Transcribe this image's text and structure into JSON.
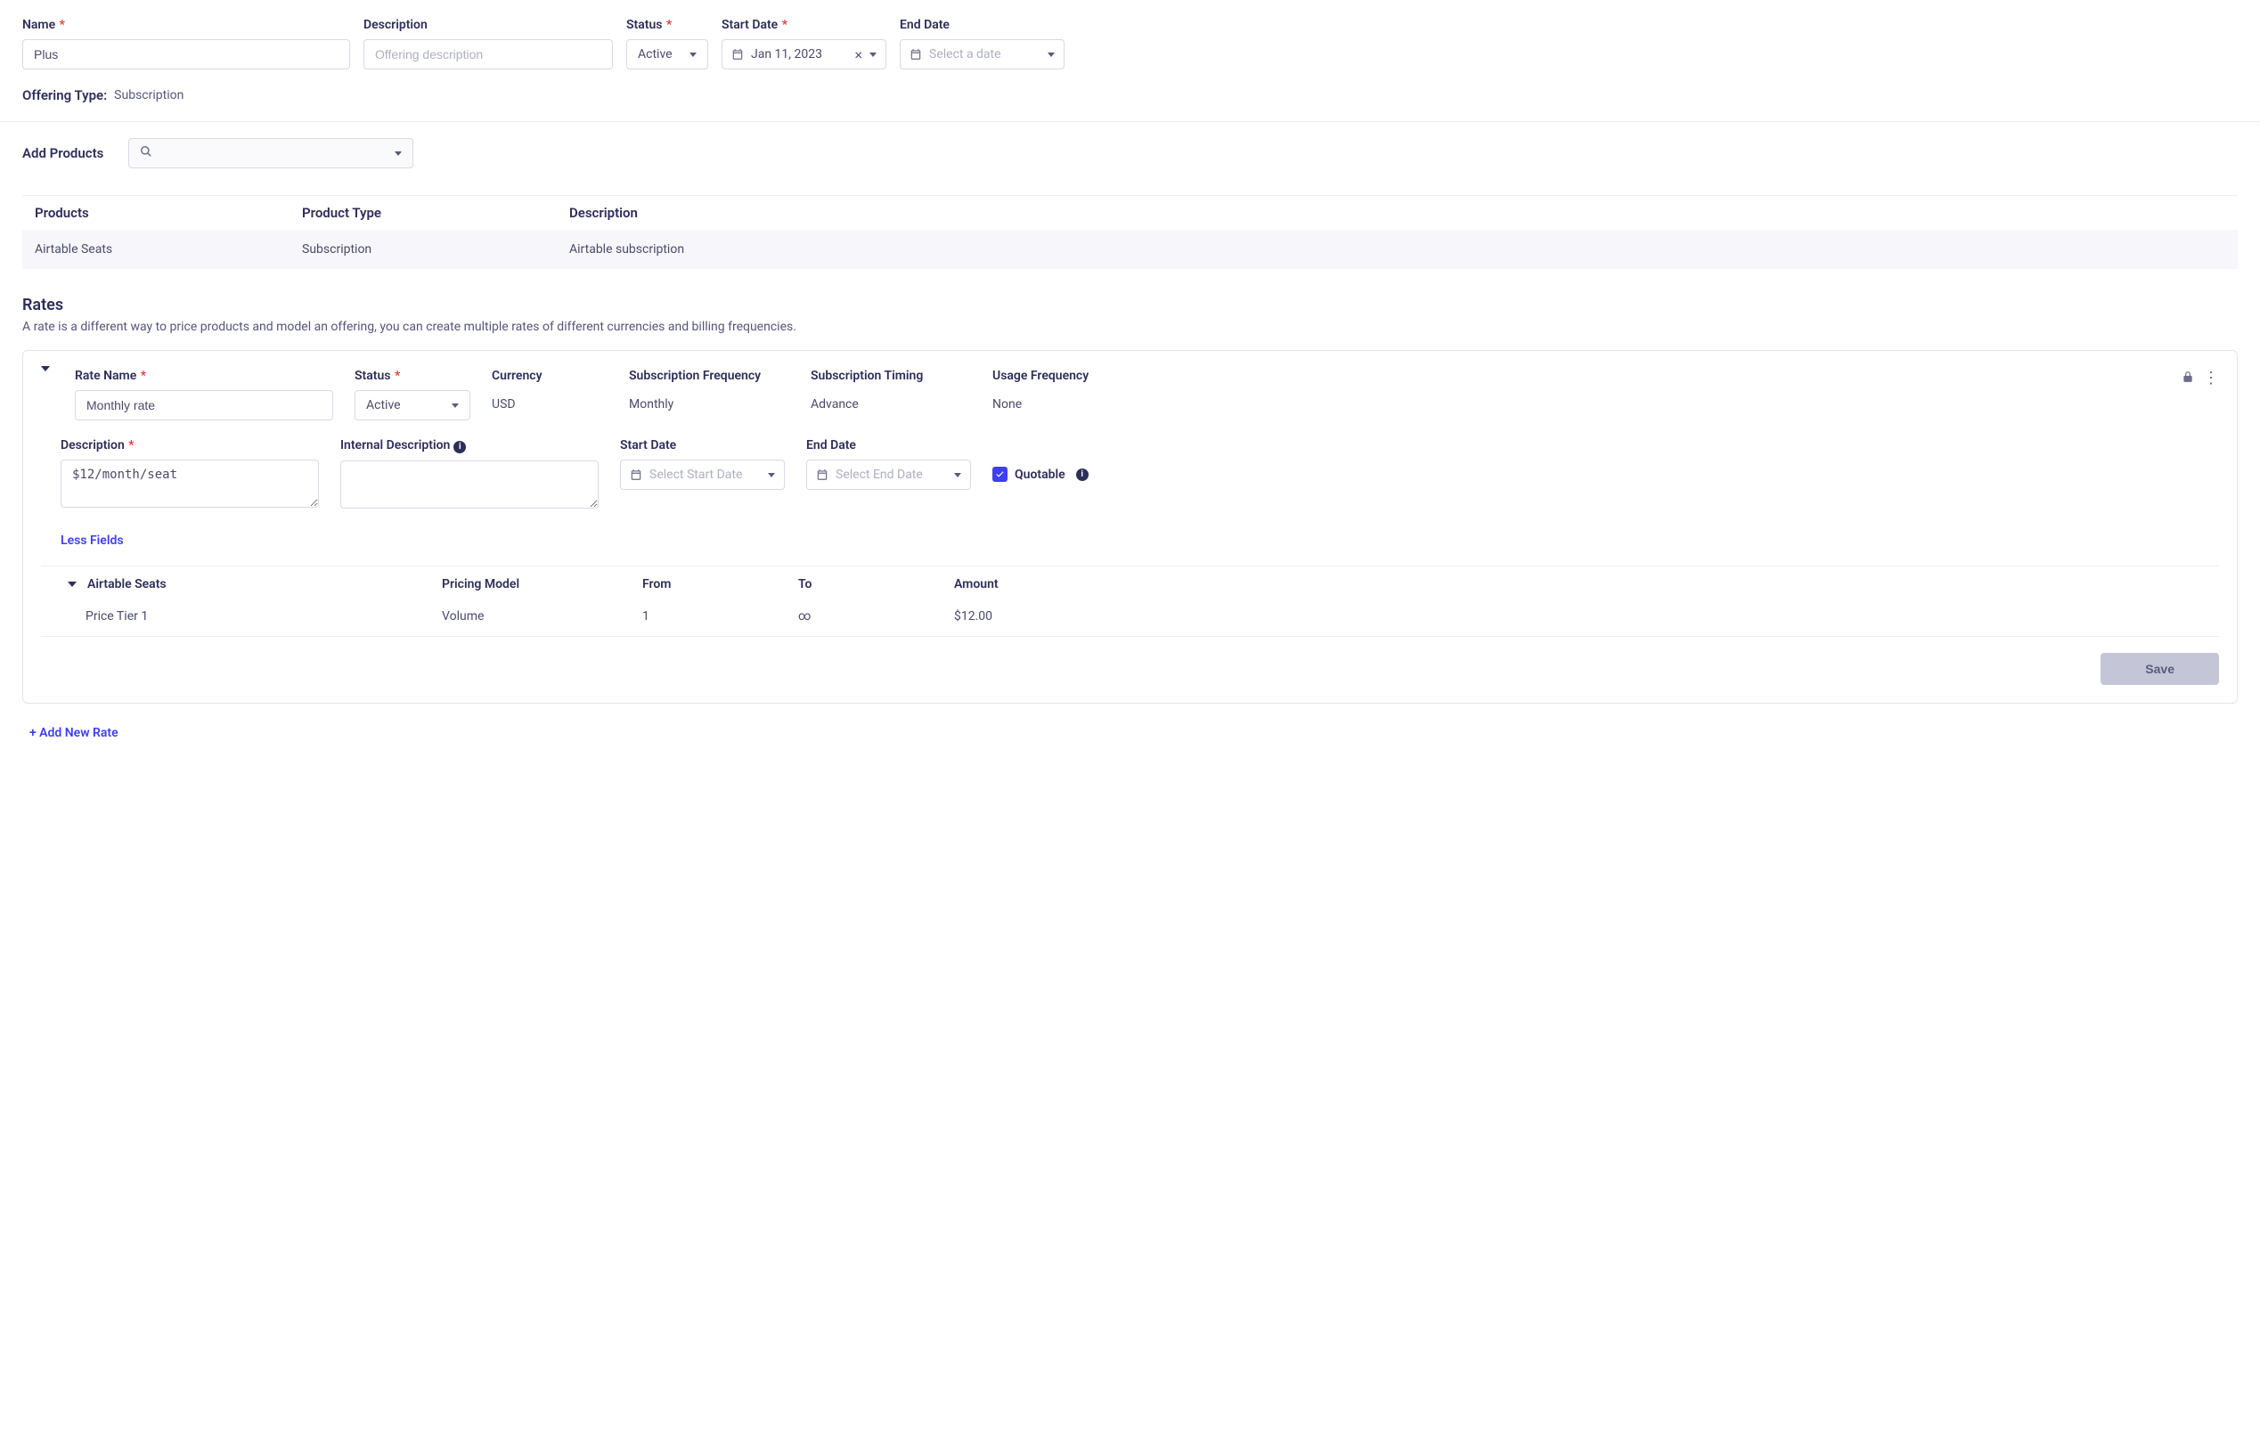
{
  "header": {
    "name_label": "Name",
    "name_value": "Plus",
    "description_label": "Description",
    "description_placeholder": "Offering description",
    "status_label": "Status",
    "status_value": "Active",
    "start_date_label": "Start Date",
    "start_date_value": "Jan 11, 2023",
    "end_date_label": "End Date",
    "end_date_placeholder": "Select a date"
  },
  "offering_type": {
    "label": "Offering Type:",
    "value": "Subscription"
  },
  "add_products": {
    "label": "Add Products"
  },
  "products_table": {
    "headers": {
      "c1": "Products",
      "c2": "Product Type",
      "c3": "Description"
    },
    "rows": [
      {
        "c1": "Airtable Seats",
        "c2": "Subscription",
        "c3": "Airtable subscription"
      }
    ]
  },
  "rates": {
    "title": "Rates",
    "subtitle": "A rate is a different way to price products and model an offering, you can create multiple rates of different currencies and billing frequencies."
  },
  "rate": {
    "name_label": "Rate Name",
    "name_value": "Monthly rate",
    "status_label": "Status",
    "status_value": "Active",
    "currency_label": "Currency",
    "currency_value": "USD",
    "sub_freq_label": "Subscription Frequency",
    "sub_freq_value": "Monthly",
    "sub_timing_label": "Subscription Timing",
    "sub_timing_value": "Advance",
    "usage_freq_label": "Usage Frequency",
    "usage_freq_value": "None",
    "description_label": "Description",
    "description_value": "$12/month/seat",
    "internal_desc_label": "Internal Description",
    "start_date_label": "Start Date",
    "start_date_placeholder": "Select Start Date",
    "end_date_label": "End Date",
    "end_date_placeholder": "Select End Date",
    "quotable_label": "Quotable",
    "less_fields": "Less Fields"
  },
  "pricing": {
    "product_name": "Airtable Seats",
    "model_header": "Pricing Model",
    "from_header": "From",
    "to_header": "To",
    "amount_header": "Amount",
    "tier_name": "Price Tier 1",
    "model_value": "Volume",
    "from_value": "1",
    "to_value": "∞",
    "amount_value": "$12.00"
  },
  "buttons": {
    "save": "Save",
    "add_rate": "+ Add New Rate"
  }
}
